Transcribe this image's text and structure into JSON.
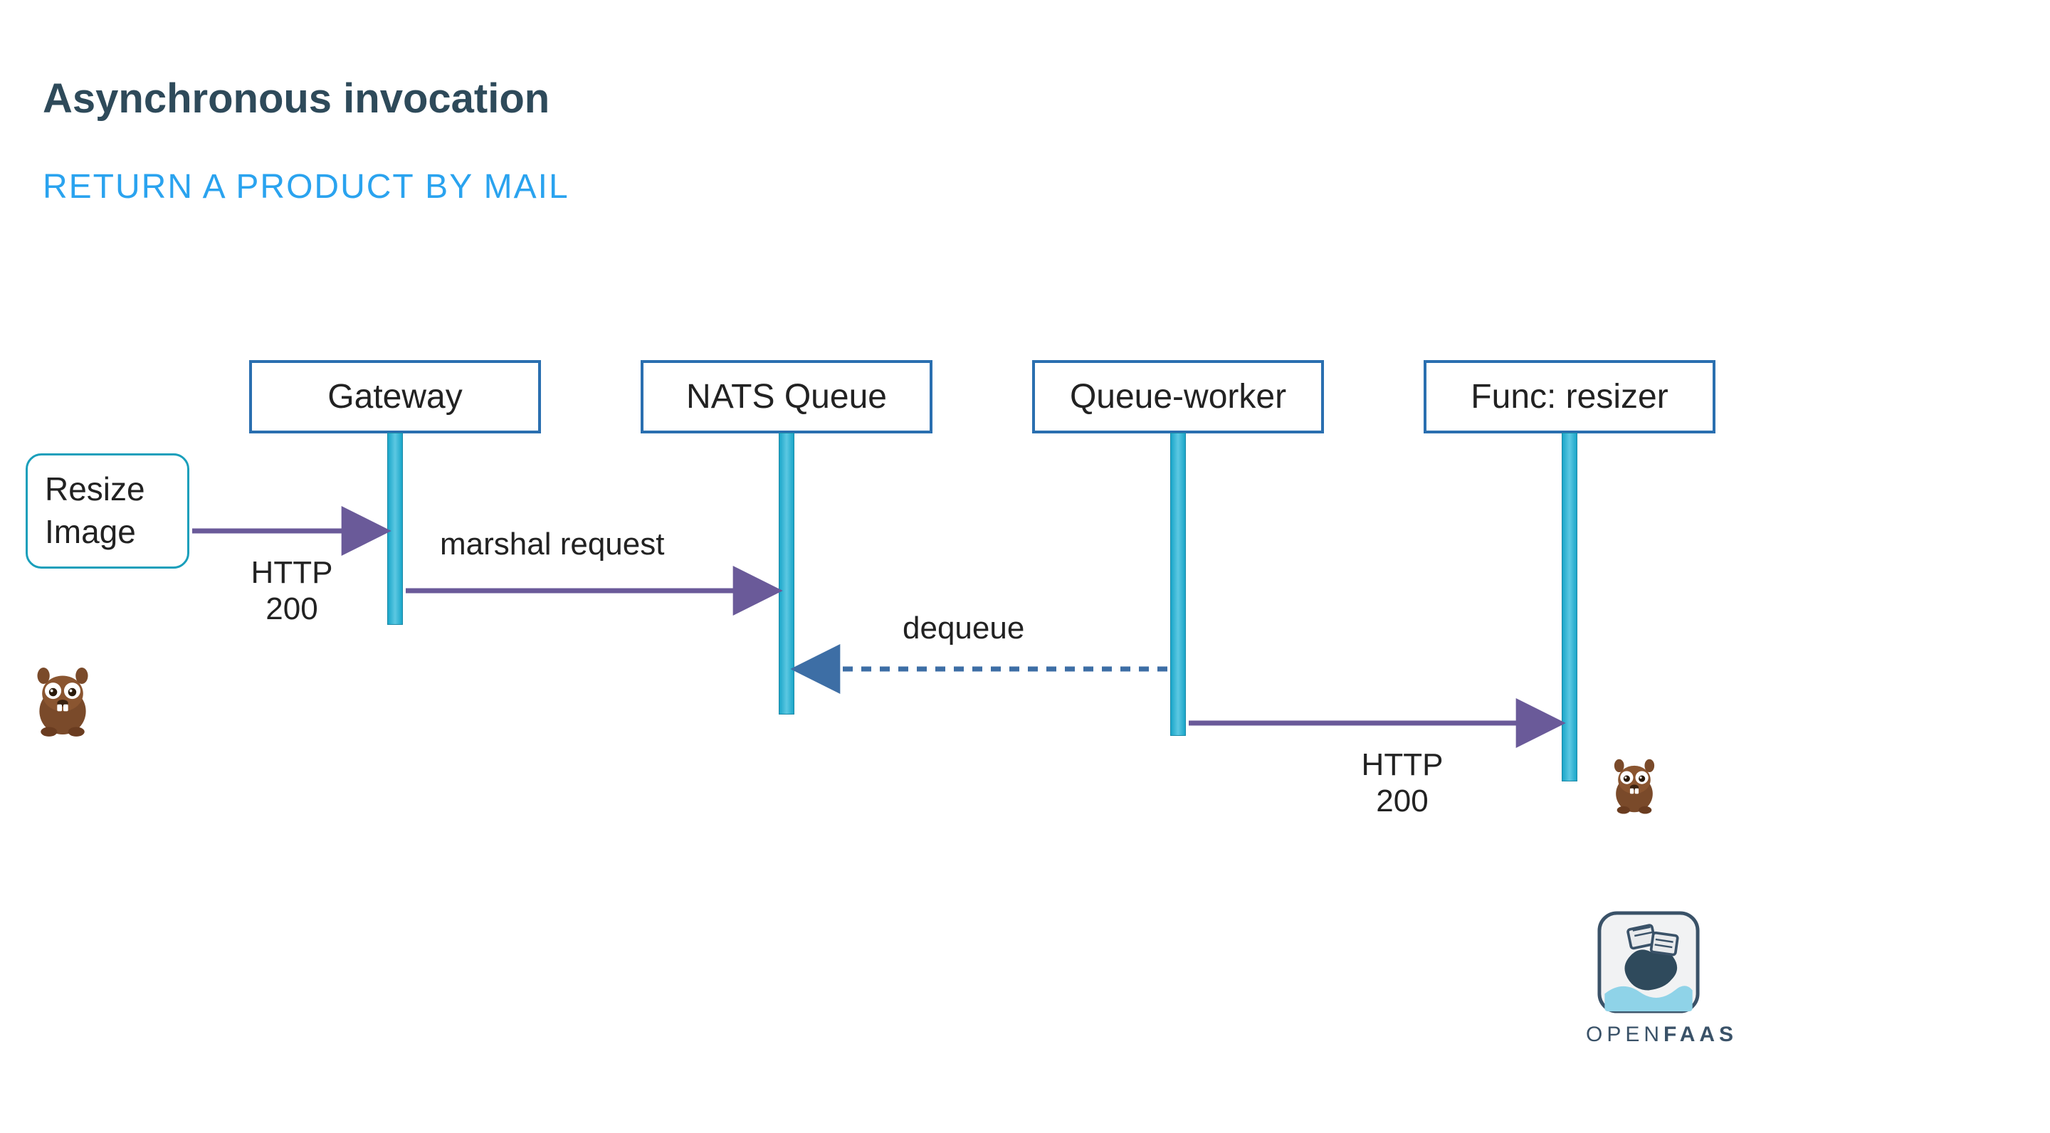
{
  "title": "Asynchronous invocation",
  "subtitle": "RETURN A PRODUCT BY MAIL",
  "actor": {
    "line1": "Resize",
    "line2": "Image"
  },
  "participants": {
    "gateway": "Gateway",
    "nats_queue": "NATS Queue",
    "queue_worker": "Queue-worker",
    "func_resizer": "Func: resizer"
  },
  "messages": {
    "actor_to_gateway": "HTTP 200",
    "gateway_to_nats": "marshal request",
    "nats_to_worker": "dequeue",
    "worker_to_resizer": "HTTP 200"
  },
  "logo": {
    "text": "OPENFAAS"
  },
  "colors": {
    "title": "#2e4a5a",
    "subtitle": "#2aa3ef",
    "box_border": "#2a6fb0",
    "lifeline": "#24b0d1",
    "arrow_solid": "#6a5a99",
    "arrow_dashed": "#3d6ea5"
  },
  "chart_data": {
    "type": "sequence-diagram",
    "title": "Asynchronous invocation — Return a product by mail",
    "actors": [
      "Resize Image"
    ],
    "participants": [
      "Gateway",
      "NATS Queue",
      "Queue-worker",
      "Func: resizer"
    ],
    "messages": [
      {
        "from": "Resize Image",
        "to": "Gateway",
        "label": "HTTP 200",
        "style": "solid"
      },
      {
        "from": "Gateway",
        "to": "NATS Queue",
        "label": "marshal request",
        "style": "solid"
      },
      {
        "from": "Queue-worker",
        "to": "NATS Queue",
        "label": "dequeue",
        "style": "dashed"
      },
      {
        "from": "Queue-worker",
        "to": "Func: resizer",
        "label": "HTTP 200",
        "style": "solid"
      }
    ]
  }
}
